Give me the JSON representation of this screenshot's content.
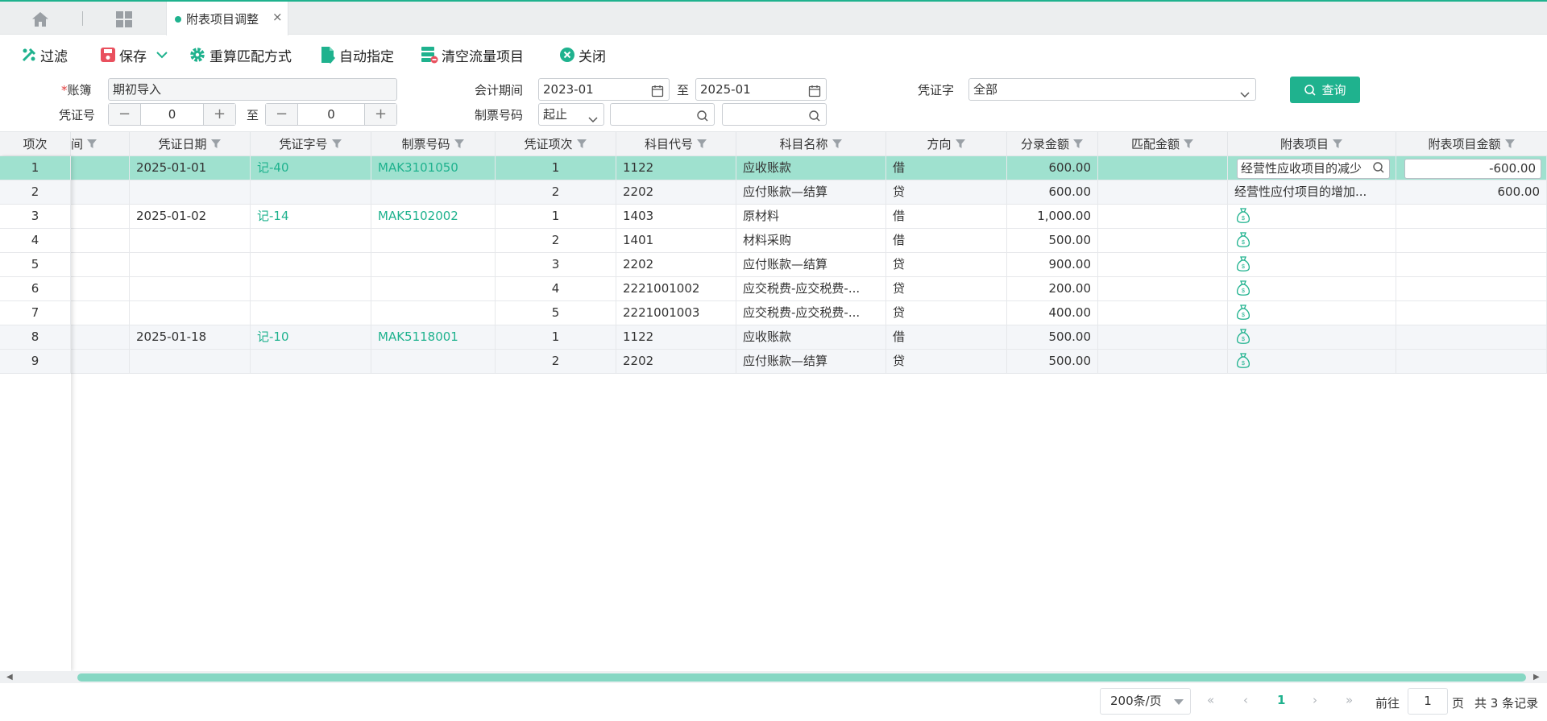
{
  "colors": {
    "accent": "#1fb28e",
    "selected_row": "#9fe1cf",
    "required": "#e23b3b"
  },
  "tabs": {
    "active_label": "附表项目调整",
    "close_glyph": "×"
  },
  "toolbar": {
    "filter": "过滤",
    "save": "保存",
    "recalc": "重算匹配方式",
    "auto_assign": "自动指定",
    "clear_flow": "清空流量项目",
    "close": "关闭"
  },
  "form": {
    "ledger_label": "账簿",
    "ledger_value": "期初导入",
    "period_label": "会计期间",
    "period_from": "2023-01",
    "to": "至",
    "period_to": "2025-01",
    "voucher_type_label": "凭证字",
    "voucher_type_value": "全部",
    "voucher_no_label": "凭证号",
    "voucher_no_from": "0",
    "voucher_no_to": "0",
    "ticket_no_label": "制票号码",
    "ticket_mode": "起止",
    "query": "查询"
  },
  "table": {
    "headers": {
      "seq": "项次",
      "period": "间",
      "date": "凭证日期",
      "voucher": "凭证字号",
      "ticket": "制票号码",
      "item": "凭证项次",
      "code": "科目代号",
      "name": "科目名称",
      "dir": "方向",
      "amount": "分录金额",
      "match": "匹配金额",
      "attach": "附表项目",
      "attach_amount": "附表项目金额"
    },
    "rows": [
      {
        "seq": "1",
        "date": "2025-01-01",
        "voucher": "记-40",
        "ticket": "MAK3101050",
        "item": "1",
        "code": "1122",
        "name": "应收账款",
        "dir": "借",
        "amount": "600.00",
        "match": "",
        "attach": "经营性应收项目的减少",
        "attach_amount": "-600.00"
      },
      {
        "seq": "2",
        "date": "",
        "voucher": "",
        "ticket": "",
        "item": "2",
        "code": "2202",
        "name": "应付账款—结算",
        "dir": "贷",
        "amount": "600.00",
        "match": "",
        "attach": "经营性应付项目的增加...",
        "attach_amount": "600.00"
      },
      {
        "seq": "3",
        "date": "2025-01-02",
        "voucher": "记-14",
        "ticket": "MAK5102002",
        "item": "1",
        "code": "1403",
        "name": "原材料",
        "dir": "借",
        "amount": "1,000.00",
        "match": "",
        "attach": "",
        "attach_amount": ""
      },
      {
        "seq": "4",
        "date": "",
        "voucher": "",
        "ticket": "",
        "item": "2",
        "code": "1401",
        "name": "材料采购",
        "dir": "借",
        "amount": "500.00",
        "match": "",
        "attach": "",
        "attach_amount": ""
      },
      {
        "seq": "5",
        "date": "",
        "voucher": "",
        "ticket": "",
        "item": "3",
        "code": "2202",
        "name": "应付账款—结算",
        "dir": "贷",
        "amount": "900.00",
        "match": "",
        "attach": "",
        "attach_amount": ""
      },
      {
        "seq": "6",
        "date": "",
        "voucher": "",
        "ticket": "",
        "item": "4",
        "code": "2221001002",
        "name": "应交税费-应交税费-...",
        "dir": "贷",
        "amount": "200.00",
        "match": "",
        "attach": "",
        "attach_amount": ""
      },
      {
        "seq": "7",
        "date": "",
        "voucher": "",
        "ticket": "",
        "item": "5",
        "code": "2221001003",
        "name": "应交税费-应交税费-...",
        "dir": "贷",
        "amount": "400.00",
        "match": "",
        "attach": "",
        "attach_amount": ""
      },
      {
        "seq": "8",
        "date": "2025-01-18",
        "voucher": "记-10",
        "ticket": "MAK5118001",
        "item": "1",
        "code": "1122",
        "name": "应收账款",
        "dir": "借",
        "amount": "500.00",
        "match": "",
        "attach": "",
        "attach_amount": ""
      },
      {
        "seq": "9",
        "date": "",
        "voucher": "",
        "ticket": "",
        "item": "2",
        "code": "2202",
        "name": "应付账款—结算",
        "dir": "贷",
        "amount": "500.00",
        "match": "",
        "attach": "",
        "attach_amount": ""
      }
    ]
  },
  "pager": {
    "page_size": "200条/页",
    "current_page": "1",
    "goto_label": "前往",
    "goto_value": "1",
    "page_unit": "页",
    "total": "共 3 条记录"
  }
}
